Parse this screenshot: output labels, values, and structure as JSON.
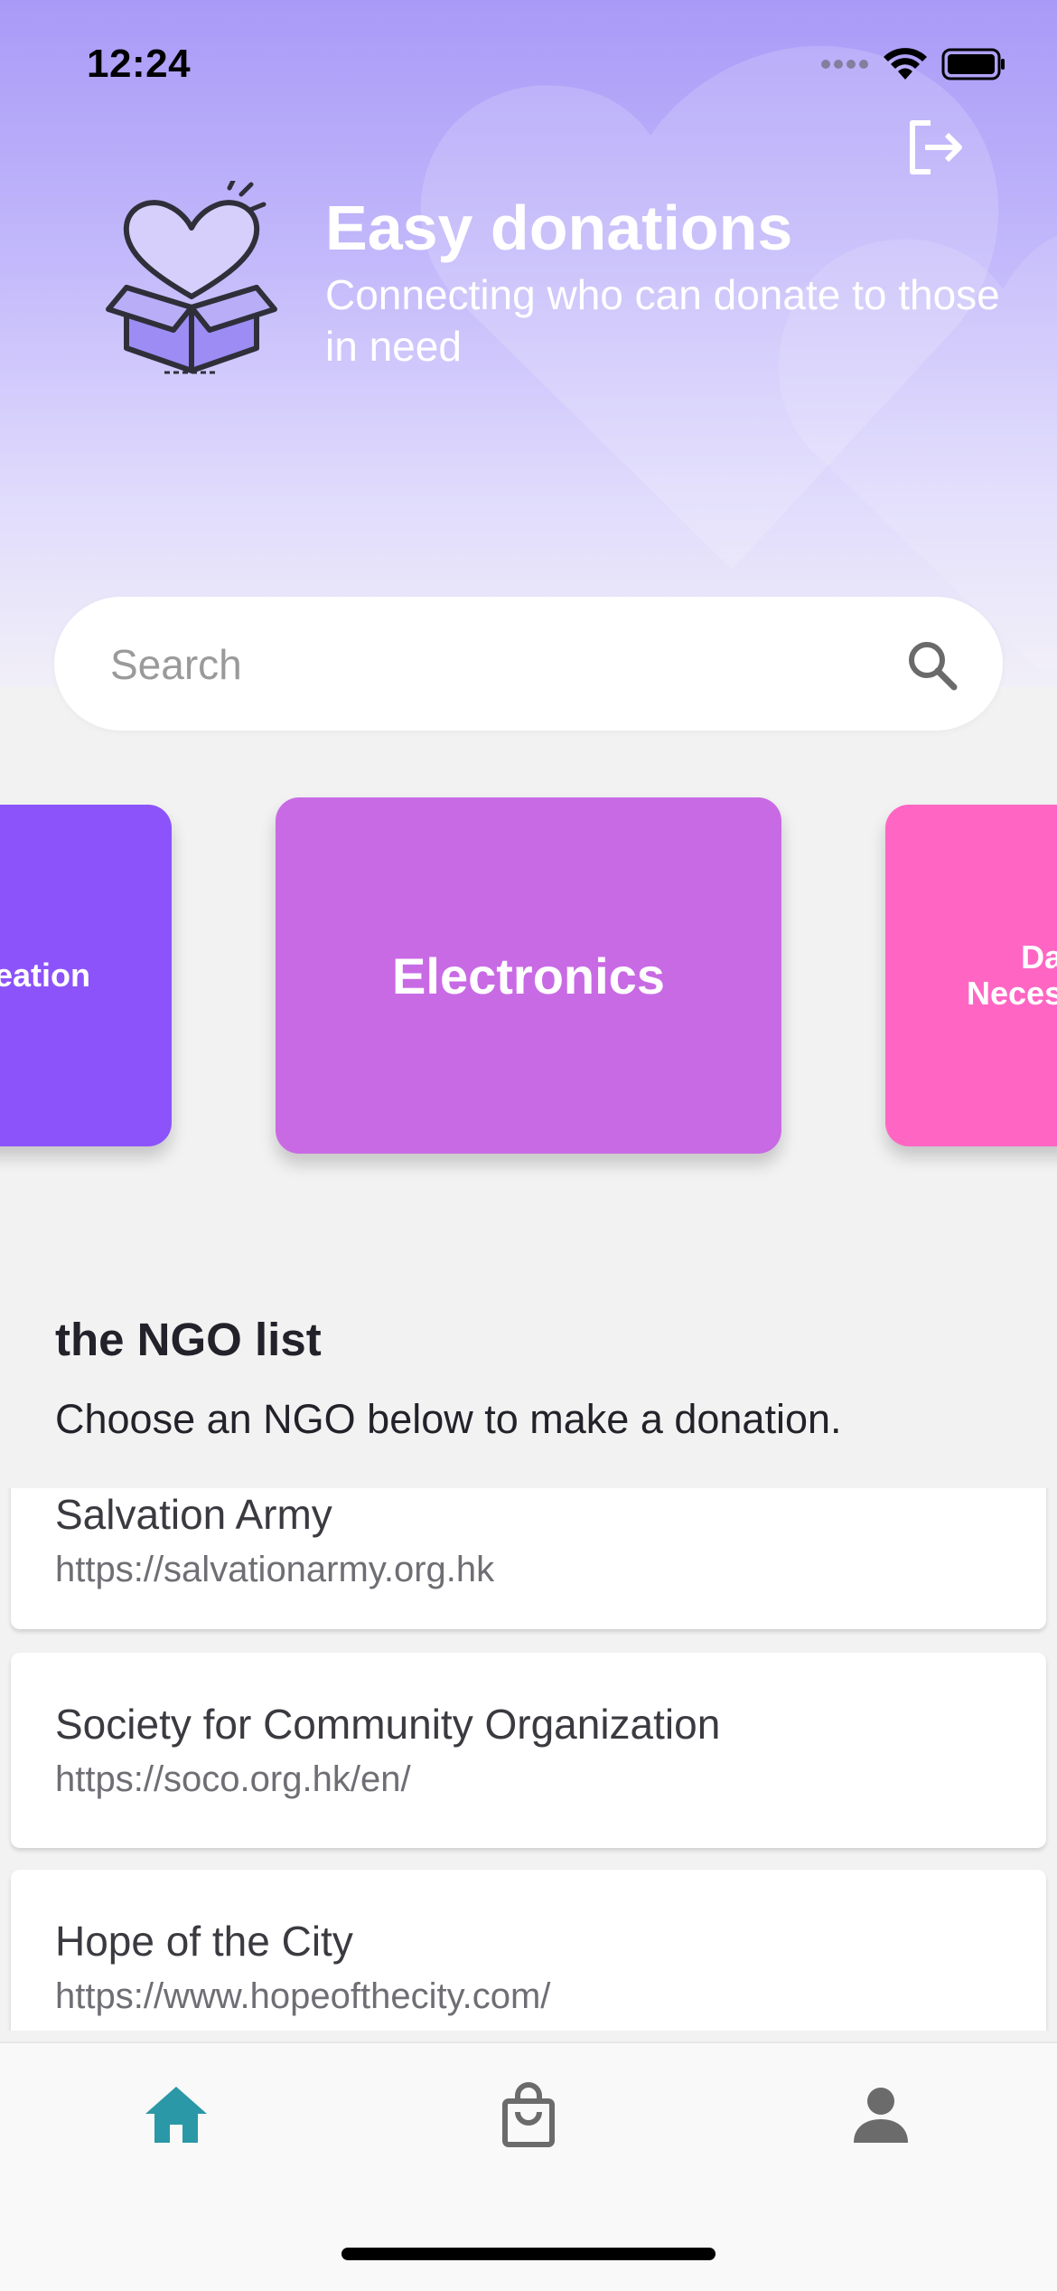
{
  "status_bar": {
    "time": "12:24"
  },
  "header": {
    "title": "Easy donations",
    "subtitle": "Connecting who can donate to those in need"
  },
  "search": {
    "placeholder": "Search"
  },
  "categories": [
    {
      "label": "eation",
      "color": "#8c53fb"
    },
    {
      "label": "Electronics",
      "color": "#c96ae5"
    },
    {
      "label": "Da\nNeces",
      "color": "#ff66c3"
    }
  ],
  "ngo_section": {
    "title": "the NGO list",
    "description": "Choose an NGO below to make a donation.",
    "items": [
      {
        "name": "Salvation Army",
        "url": "https://salvationarmy.org.hk"
      },
      {
        "name": "Society for Community Organization",
        "url": "https://soco.org.hk/en/"
      },
      {
        "name": "Hope of the City",
        "url": "https://www.hopeofthecity.com/"
      }
    ]
  },
  "tab_bar": {
    "active_color": "#2a98a6",
    "inactive_color": "#6b6b6b",
    "tabs": [
      {
        "icon": "home-icon",
        "active": true
      },
      {
        "icon": "shopping-bag-icon",
        "active": false
      },
      {
        "icon": "person-icon",
        "active": false
      }
    ]
  }
}
